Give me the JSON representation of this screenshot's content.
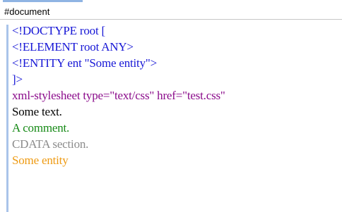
{
  "header": {
    "label": "#document"
  },
  "lines": [
    {
      "text": "<!DOCTYPE root [",
      "kind": "doctype"
    },
    {
      "text": "<!ELEMENT root ANY>",
      "kind": "doctype"
    },
    {
      "text": "<!ENTITY ent \"Some entity\">",
      "kind": "doctype"
    },
    {
      "text": "]>",
      "kind": "doctype"
    },
    {
      "text": "xml-stylesheet type=\"text/css\" href=\"test.css\"",
      "kind": "processing-instruction"
    },
    {
      "text": " Some text.",
      "kind": "text"
    },
    {
      "text": " A comment.",
      "kind": "comment"
    },
    {
      "text": "CDATA section.",
      "kind": "cdata"
    },
    {
      "text": "Some entity",
      "kind": "entity-reference"
    }
  ],
  "colors": {
    "doctype": "#1717d6",
    "processing_instruction": "#8b0b8b",
    "text": "#000000",
    "comment": "#168a16",
    "cdata": "#8c8c8c",
    "entity": "#ee9a12",
    "gutter": "#a9c4ea",
    "accent": "#8fb4e3"
  }
}
